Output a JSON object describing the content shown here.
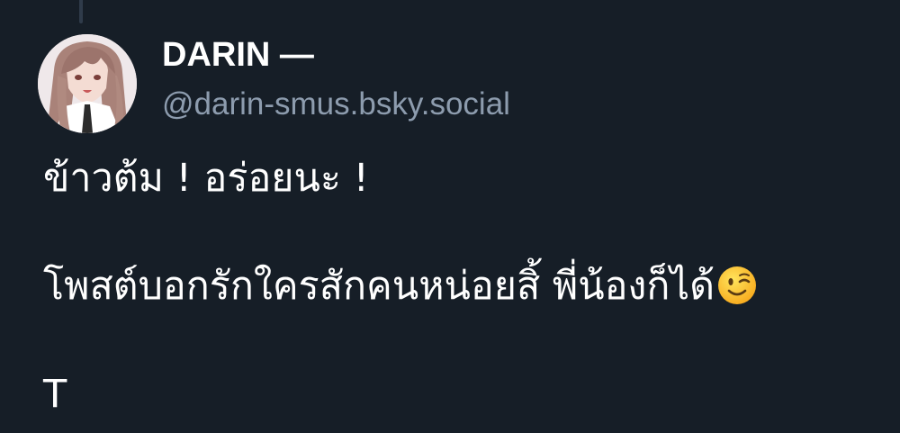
{
  "post": {
    "author": {
      "display_name": "DARIN —",
      "handle": "@darin-smus.bsky.social",
      "avatar_icon": "anime-character-avatar-icon"
    },
    "text_lines": [
      "ข้าวต้ม ! อร่อยนะ !",
      "โพสต์บอกรักใครสักคนหน่อยสิ้ พี่น้องก็ได้",
      "T"
    ],
    "emoji": "winking-face-emoji-icon"
  },
  "colors": {
    "background": "#161e27",
    "text": "#ffffff",
    "handle": "#8d9cae",
    "thread_line": "#2f3b4a"
  }
}
